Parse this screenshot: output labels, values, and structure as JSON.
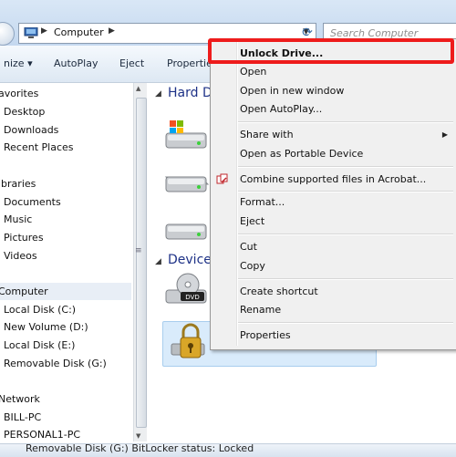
{
  "address_bar": {
    "path": "Computer",
    "search_placeholder": "Search Computer"
  },
  "toolbar": {
    "organize": "nize",
    "organize_arrow": "▾",
    "autoplay": "AutoPlay",
    "eject": "Eject",
    "properties": "Propertie"
  },
  "nav": {
    "favorites_head": "avorites",
    "favorites": [
      "Desktop",
      "Downloads",
      "Recent Places"
    ],
    "libraries_head": "ibraries",
    "libraries": [
      "Documents",
      "Music",
      "Pictures",
      "Videos"
    ],
    "computer_head": "Computer",
    "computer": [
      "Local Disk (C:)",
      "New Volume (D:)",
      "Local Disk (E:)",
      "Removable Disk (G:)"
    ],
    "network_head": "Network",
    "network": [
      "BILL-PC",
      "PERSONAL1-PC"
    ]
  },
  "main": {
    "hard_disk_head": "Hard D",
    "devices_head": "Devices"
  },
  "context_menu": {
    "items": [
      "Unlock Drive...",
      "Open",
      "Open in new window",
      "Open AutoPlay...",
      "Share with",
      "Open as Portable Device",
      "Combine supported files in Acrobat...",
      "Format...",
      "Eject",
      "Cut",
      "Copy",
      "Create shortcut",
      "Rename",
      "Properties"
    ]
  },
  "status_bar": {
    "text": "Removable Disk (G:)  BitLocker status: Locked"
  },
  "colors": {
    "highlight": "#ee1c1c",
    "group_heading": "#1e3287",
    "selection": "#d9ebfb"
  }
}
